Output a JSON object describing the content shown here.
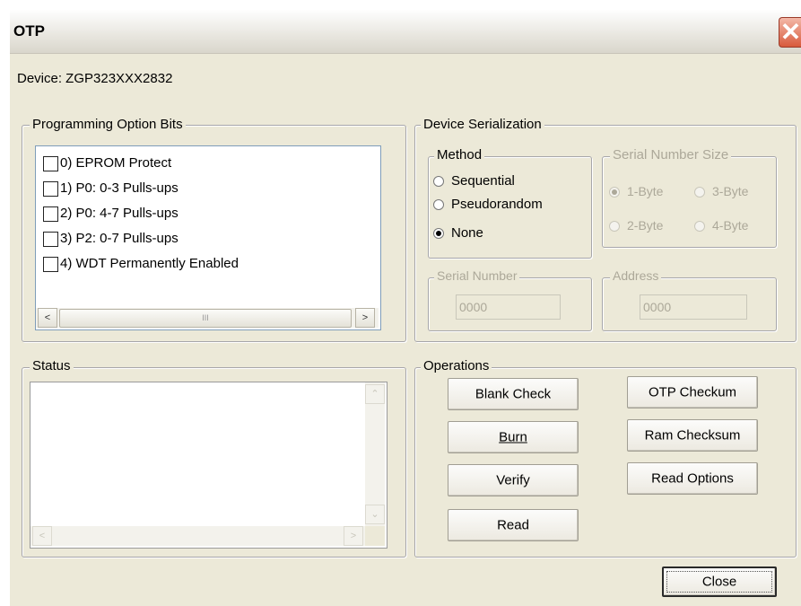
{
  "window": {
    "title": "OTP",
    "close_glyph": "✕"
  },
  "device": {
    "label": "Device: ZGP323XXX2832"
  },
  "option_bits": {
    "group_label": "Programming Option Bits",
    "items": [
      {
        "label": "0) EPROM Protect",
        "checked": false
      },
      {
        "label": "1) P0: 0-3 Pulls-ups",
        "checked": false
      },
      {
        "label": "2) P0: 4-7 Pulls-ups",
        "checked": false
      },
      {
        "label": "3) P2: 0-7 Pulls-ups",
        "checked": false
      },
      {
        "label": "4) WDT Permanently Enabled",
        "checked": false
      }
    ],
    "scroll_left": "<",
    "scroll_right": ">",
    "scroll_grip": "III"
  },
  "serialization": {
    "group_label": "Device Serialization",
    "method": {
      "label": "Method",
      "options": [
        "Sequential",
        "Pseudorandom",
        "None"
      ],
      "selected": "None"
    },
    "size": {
      "label": "Serial Number Size",
      "options": [
        "1-Byte",
        "3-Byte",
        "2-Byte",
        "4-Byte"
      ],
      "selected": "1-Byte"
    },
    "serial_number": {
      "label": "Serial Number",
      "value": "0000"
    },
    "address": {
      "label": "Address",
      "value": "0000"
    }
  },
  "status": {
    "group_label": "Status",
    "up": "⌃",
    "down": "⌄",
    "left": "<",
    "right": ">"
  },
  "operations": {
    "group_label": "Operations",
    "blank_check": "Blank Check",
    "burn": "Burn",
    "verify": "Verify",
    "read": "Read",
    "otp_checksum": "OTP Checkum",
    "ram_checksum": "Ram Checksum",
    "read_options": "Read Options"
  },
  "close_label": "Close"
}
